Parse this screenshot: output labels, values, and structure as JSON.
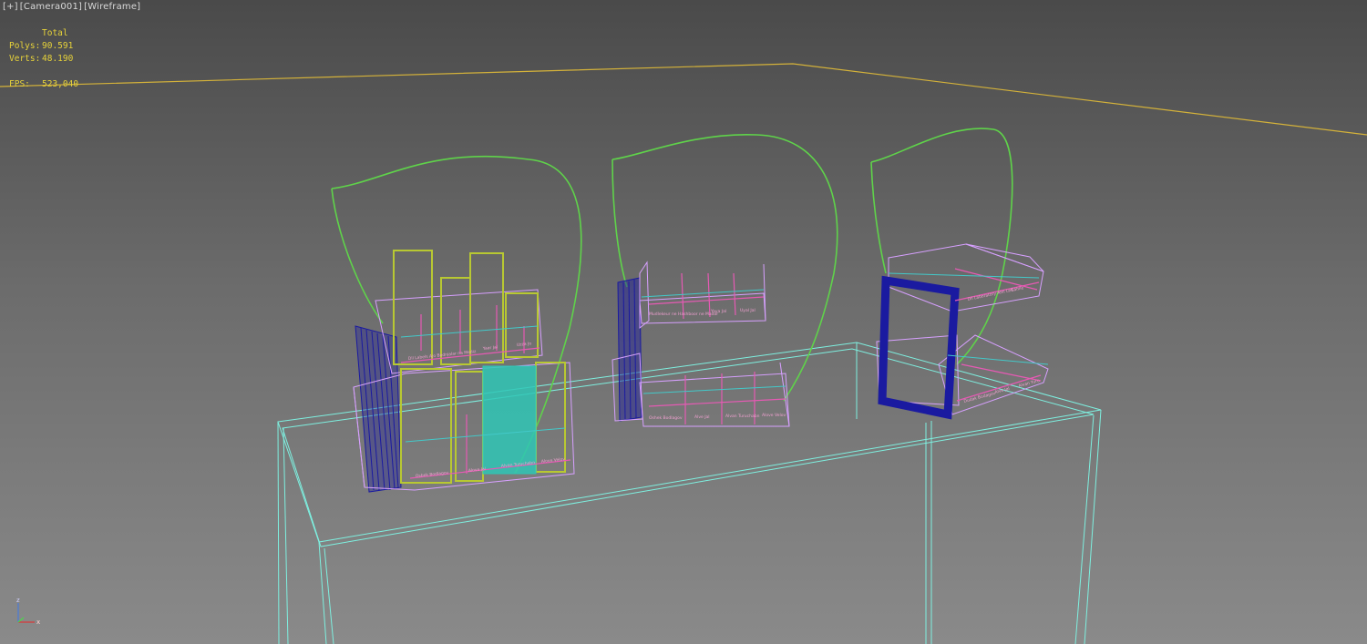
{
  "viewport": {
    "labels": [
      "[+]",
      "[Camera001]",
      "[Wireframe]"
    ]
  },
  "stats": {
    "header": "Total",
    "polys_label": "Polys:",
    "polys_value": "90.591",
    "verts_label": "Verts:",
    "verts_value": "48.190",
    "fps_label": "FPS:",
    "fps_value": "523,040"
  },
  "axis": {
    "z": "z",
    "x": "x"
  },
  "colors": {
    "stats_text": "#e6d23a",
    "horizon": "#d4b23a",
    "table": "#7ef0e0",
    "sign_outline": "#5fd34a",
    "olive": "#b8c832",
    "pink": "#e65ab4",
    "violet": "#d7a0ff",
    "navy": "#1a1aa0",
    "teal": "#2fc5b5",
    "cyan_line": "#43c9c9"
  },
  "display1": {
    "top_labels": [
      "Dil Labels Ajo Bodnjalar na Mediz",
      "Yaar Jal",
      "Uzza Jo"
    ],
    "bottom_labels": [
      "Osbek Bodlagov",
      "Alove Jal",
      "Alvan Turuchabn",
      "Alove Velov"
    ]
  },
  "display2": {
    "top_labels": [
      "Mudlekeur ne Hashboor ne Mador",
      "Yaya Jal",
      "Uyal Jal"
    ],
    "bottom_labels": [
      "Oshek Bodlagov",
      "Alve Jal",
      "Alvan Turuchabn",
      "Alove Velov"
    ]
  },
  "display3": {
    "top_labels": [
      "Dil Laboratory Ahli Lek",
      "Sahile"
    ],
    "bottom_labels": [
      "Dudak Bodagov",
      "Alve Jal",
      "Alvan Yuru"
    ]
  }
}
